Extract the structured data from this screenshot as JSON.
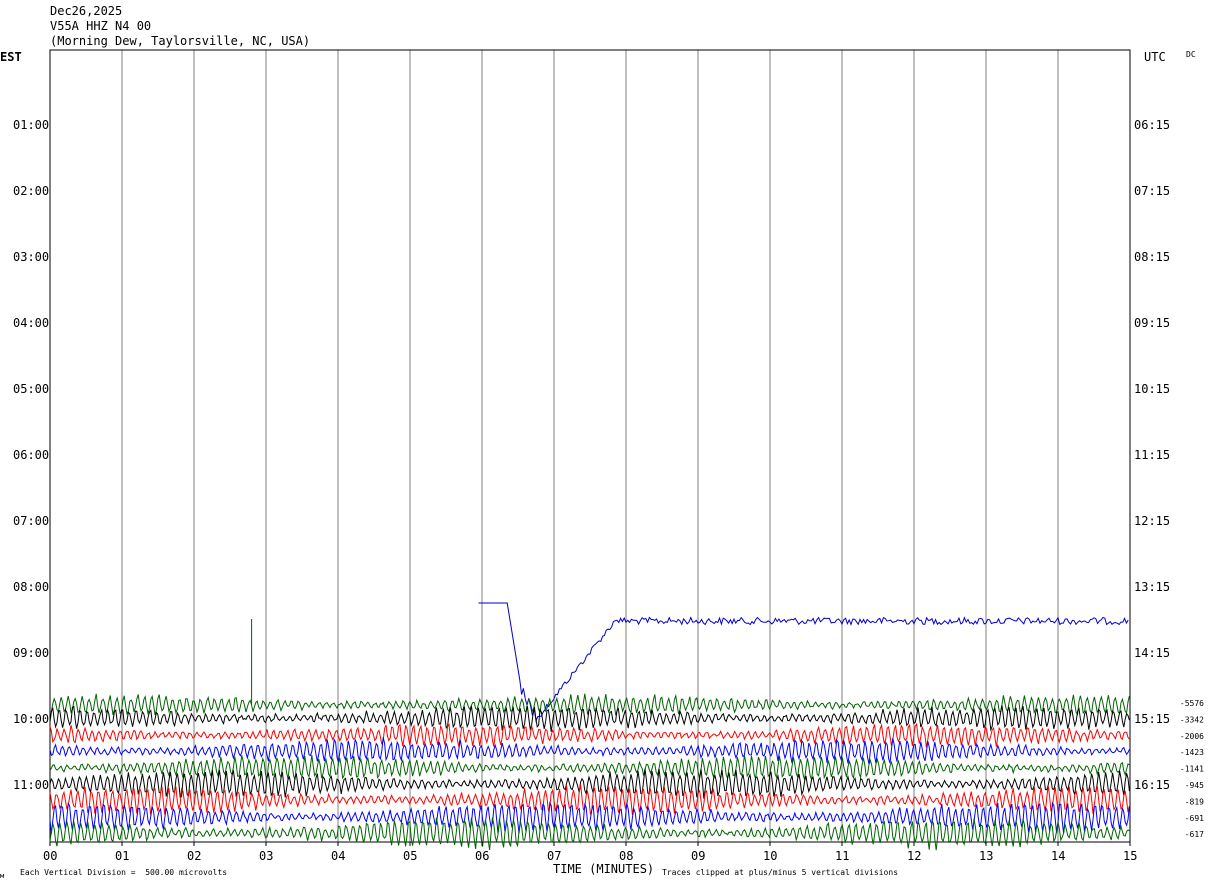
{
  "header": {
    "date": "Dec26,2025",
    "station": "V55A HHZ N4 00",
    "location": "(Morning Dew, Taylorsville, NC, USA)"
  },
  "chart_data": {
    "type": "line",
    "subtype": "helicorder",
    "left_zone_label": "EST",
    "right_zone_label": "UTC",
    "corner_label": "DC",
    "xlabel": "TIME (MINUTES)",
    "x_ticks": [
      "00",
      "01",
      "02",
      "03",
      "04",
      "05",
      "06",
      "07",
      "08",
      "09",
      "10",
      "11",
      "12",
      "13",
      "14",
      "15"
    ],
    "xlim": [
      0,
      15
    ],
    "left_hour_labels": [
      "01:00",
      "02:00",
      "03:00",
      "04:00",
      "05:00",
      "06:00",
      "07:00",
      "08:00",
      "09:00",
      "10:00",
      "11:00"
    ],
    "right_hour_labels": [
      "06:15",
      "07:15",
      "08:15",
      "09:15",
      "10:15",
      "11:15",
      "12:15",
      "13:15",
      "14:15",
      "15:15",
      "16:15"
    ],
    "trace_colors": [
      "#006400",
      "#000000",
      "#ff0000",
      "#0000ff"
    ],
    "trace_offsets": [
      "-5576",
      "-3342",
      "-2006",
      "-1423",
      "-1141",
      "-945",
      "-819",
      "-691",
      "-617"
    ],
    "vertical_division": "500.00 microvolts",
    "footer_left": "Each Vertical Division =  500.00 microvolts",
    "footer_right": "Traces clipped at plus/minus 5 vertical divisions",
    "events": [
      {
        "type": "spike",
        "minute": 2.8,
        "note": "single vertical spike on 09:45 line"
      },
      {
        "type": "offset",
        "start_minute": 5.95,
        "end_minute": 7.9,
        "note": "blue trace step at 08:15 line"
      }
    ],
    "grid": true
  }
}
